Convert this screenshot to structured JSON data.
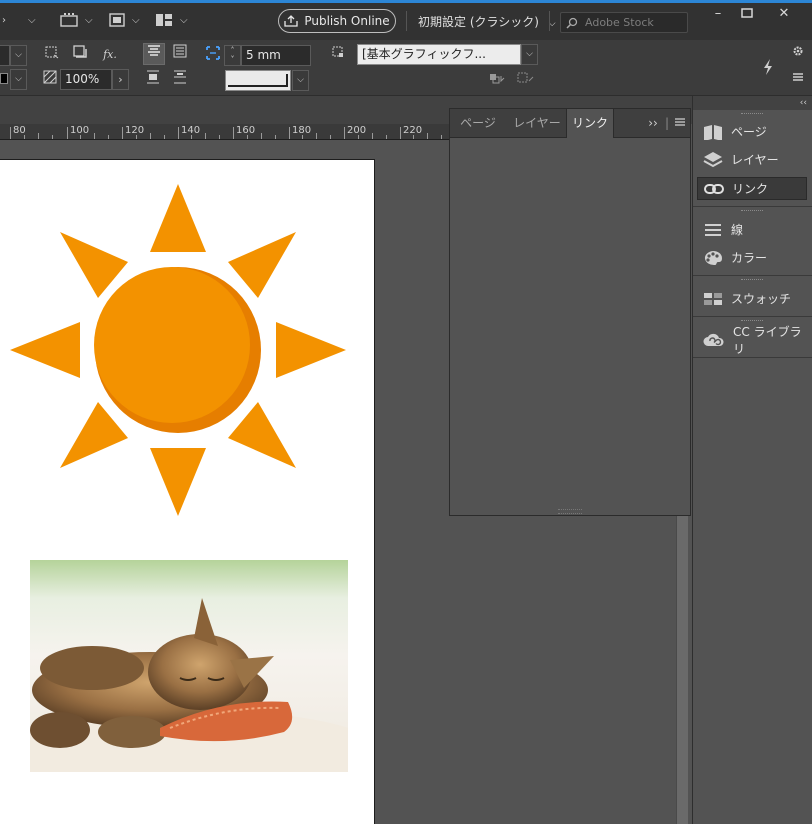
{
  "appbar": {
    "publish_label": "Publish Online",
    "workspace_label": "初期設定 (クラシック)",
    "stock_placeholder": "Adobe Stock",
    "window_controls": [
      "minimize-icon",
      "maximize-icon",
      "close-icon"
    ]
  },
  "control_panel": {
    "scale_value": "100%",
    "gap_value": "5 mm",
    "object_style_value": "[基本グラフィックフ..."
  },
  "ruler": {
    "ticks": [
      "80",
      "100",
      "120",
      "140",
      "160",
      "180",
      "200",
      "220"
    ]
  },
  "links_panel": {
    "tabs": [
      "ページ",
      "レイヤー",
      "リンク"
    ],
    "active_tab": "リンク",
    "overflow_label": "››"
  },
  "dock": {
    "items": [
      {
        "label": "ページ",
        "icon": "pages-icon"
      },
      {
        "label": "レイヤー",
        "icon": "layers-icon"
      },
      {
        "label": "リンク",
        "icon": "links-icon",
        "selected": true
      },
      {
        "label": "線",
        "icon": "stroke-icon"
      },
      {
        "label": "カラー",
        "icon": "color-icon"
      },
      {
        "label": "スウォッチ",
        "icon": "swatches-icon"
      },
      {
        "label": "CC ライブラリ",
        "icon": "cc-libraries-icon"
      }
    ]
  },
  "document": {
    "images": [
      "sun-illustration",
      "sleeping-kitten-photo"
    ],
    "sun_color": "#F39200",
    "sun_shadow_color": "#E67E00"
  }
}
